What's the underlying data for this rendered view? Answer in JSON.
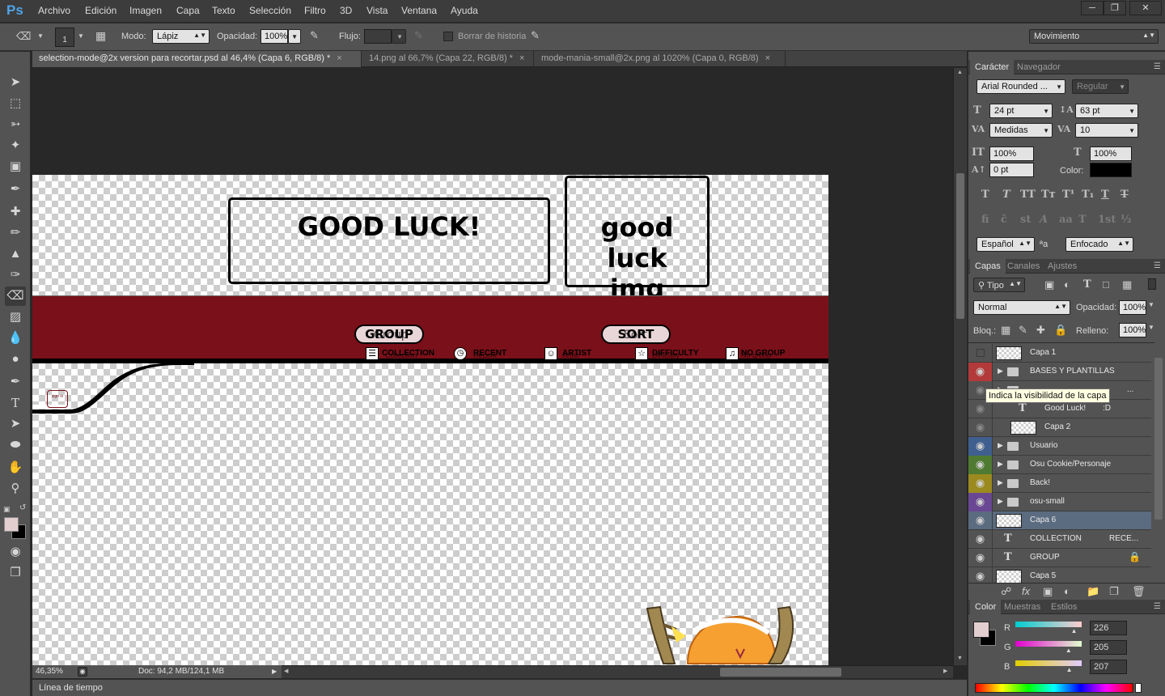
{
  "app": {
    "logo": "Ps",
    "menu": [
      "Archivo",
      "Edición",
      "Imagen",
      "Capa",
      "Texto",
      "Selección",
      "Filtro",
      "3D",
      "Vista",
      "Ventana",
      "Ayuda"
    ]
  },
  "options": {
    "brush_size": "1",
    "mode_label": "Modo:",
    "mode_value": "Lápiz",
    "opacity_label": "Opacidad:",
    "opacity_value": "100%",
    "flow_label": "Flujo:",
    "flow_value": "",
    "erase_history_label": "Borrar de historia",
    "workspace": "Movimiento"
  },
  "tabs": [
    {
      "label": "selection-mode@2x version para recortar.psd al 46,4% (Capa 6, RGB/8) *",
      "active": true
    },
    {
      "label": "14.png al 66,7% (Capa 22, RGB/8) *",
      "active": false
    },
    {
      "label": "mode-mania-small@2x.png al 1020% (Capa 0, RGB/8)",
      "active": false
    }
  ],
  "canvas": {
    "good_luck_text": "GOOD LUCK!",
    "good_luck_img_line1": "good luck",
    "good_luck_img_line2": "img",
    "group_button": "GROUP",
    "group_overlay": "Group",
    "sort_button": "SORT",
    "sort_overlay": "Sort",
    "icon_labels": [
      "COLLECTION",
      "RECENT",
      "ARTIST",
      "DIFFICULTY",
      "NO GROUP"
    ],
    "icon_labels_overlay": [
      "Collection",
      "Recent",
      "Artist",
      "Difficulty",
      "No group"
    ],
    "avatar_text": "sign in"
  },
  "status": {
    "zoom": "46,35%",
    "doc": "Doc: 94,2 MB/124,1 MB"
  },
  "timeline": {
    "label": "Línea de tiempo"
  },
  "character": {
    "tabs": [
      "Carácter",
      "Navegador"
    ],
    "font_family": "Arial Rounded ...",
    "font_style": "Regular",
    "size": "24 pt",
    "leading": "63 pt",
    "kerning": "Medidas",
    "tracking": "10",
    "vscale": "100%",
    "hscale": "100%",
    "baseline": "0 pt",
    "color_label": "Color:",
    "text_color": "#000000",
    "language": "Español",
    "aa_label": "ªa",
    "antialias": "Enfocado"
  },
  "layers_panel": {
    "tabs": [
      "Capas",
      "Canales",
      "Ajustes"
    ],
    "filter": "Tipo",
    "blend": "Normal",
    "opacity_label": "Opacidad:",
    "opacity": "100%",
    "lock_label": "Bloq.:",
    "fill_label": "Relleno:",
    "fill": "100%",
    "tooltip": "Indica la visibilidad de la capa",
    "layers": [
      {
        "name": "Capa 1",
        "kind": "pixel",
        "visible": false,
        "tag": "",
        "selected": false
      },
      {
        "name": "BASES Y PLANTILLAS",
        "kind": "group",
        "visible": true,
        "tag": "#b33a3a",
        "selected": false
      },
      {
        "name": "",
        "kind": "group-hidden",
        "visible": false,
        "tag": "",
        "selected": false
      },
      {
        "name": "Good Luck!",
        "extra": ":D",
        "kind": "text",
        "visible": false,
        "tag": "",
        "selected": false
      },
      {
        "name": "Capa 2",
        "kind": "pixel",
        "visible": false,
        "tag": "",
        "selected": false
      },
      {
        "name": "Usuario",
        "kind": "group",
        "visible": true,
        "tag": "#3f5f8f",
        "selected": false
      },
      {
        "name": "Osu Cookie/Personaje",
        "kind": "group",
        "visible": true,
        "tag": "#4f7a32",
        "selected": false
      },
      {
        "name": "Back!",
        "kind": "group",
        "visible": true,
        "tag": "#9b8a1f",
        "selected": false
      },
      {
        "name": "osu-small",
        "kind": "group",
        "visible": true,
        "tag": "#6a4792",
        "selected": false
      },
      {
        "name": "Capa 6",
        "kind": "pixel",
        "visible": true,
        "tag": "",
        "selected": true
      },
      {
        "name": "COLLECTION",
        "extra": "RECE...",
        "kind": "text",
        "visible": true,
        "tag": "",
        "selected": false
      },
      {
        "name": "GROUP",
        "kind": "text",
        "visible": true,
        "tag": "",
        "selected": false
      },
      {
        "name": "Capa 5",
        "kind": "pixel",
        "visible": true,
        "tag": "",
        "selected": false
      }
    ]
  },
  "color_panel": {
    "tabs": [
      "Color",
      "Muestras",
      "Estilos"
    ],
    "r_label": "R",
    "g_label": "G",
    "b_label": "B",
    "r": "226",
    "g": "205",
    "b": "207",
    "fg": "#e2cdcf",
    "bg": "#000000"
  }
}
